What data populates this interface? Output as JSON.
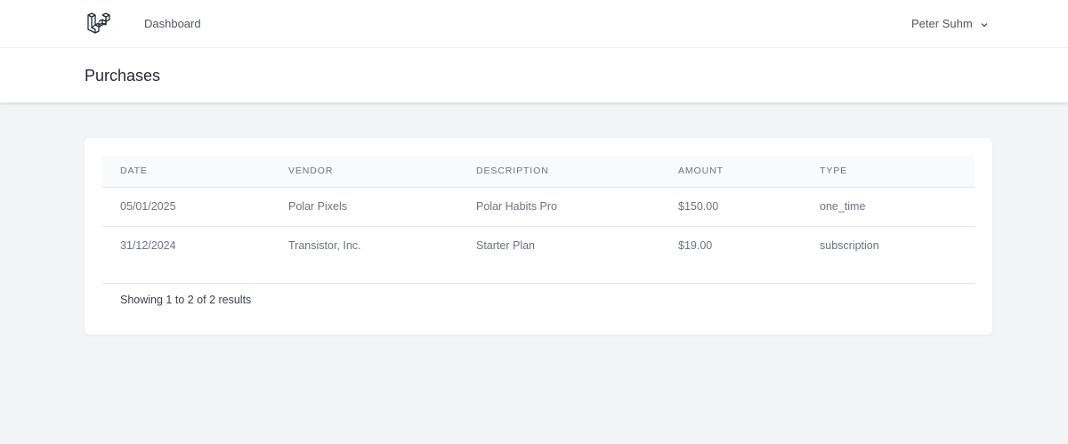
{
  "nav": {
    "logo_icon": "laravel-logo-icon",
    "links": [
      {
        "label": "Dashboard"
      }
    ],
    "user": {
      "name": "Peter Suhm",
      "chevron_icon": "chevron-down-icon"
    }
  },
  "header": {
    "title": "Purchases"
  },
  "table": {
    "columns": [
      "Date",
      "Vendor",
      "Description",
      "Amount",
      "Type"
    ],
    "rows": [
      {
        "date": "05/01/2025",
        "vendor": "Polar Pixels",
        "description": "Polar Habits Pro",
        "amount": "$150.00",
        "type": "one_time"
      },
      {
        "date": "31/12/2024",
        "vendor": "Transistor, Inc.",
        "description": "Starter Plan",
        "amount": "$19.00",
        "type": "subscription"
      }
    ]
  },
  "pagination": {
    "summary": "Showing 1 to 2 of 2 results"
  },
  "colors": {
    "background": "#f3f4f6",
    "card": "#ffffff",
    "header_row": "#f9fafb",
    "text_muted": "#6b7280"
  }
}
